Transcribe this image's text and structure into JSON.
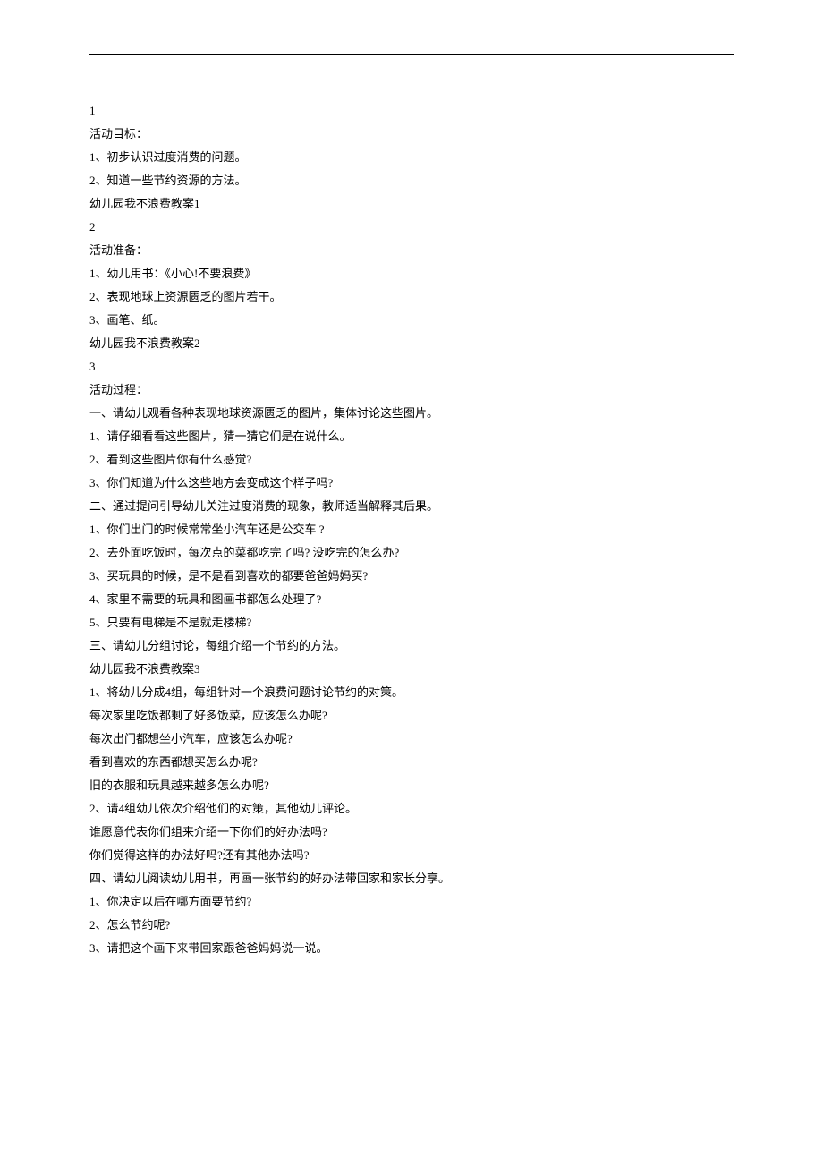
{
  "lines": [
    "1",
    "活动目标：",
    "1、初步认识过度消费的问题。",
    "2、知道一些节约资源的方法。",
    "幼儿园我不浪费教案1",
    "2",
    "活动准备：",
    "1、幼儿用书：《小心!不要浪费》",
    "2、表现地球上资源匮乏的图片若干。",
    "3、画笔、纸。",
    "幼儿园我不浪费教案2",
    "3",
    "活动过程：",
    "一、请幼儿观看各种表现地球资源匮乏的图片，集体讨论这些图片。",
    "1、请仔细看看这些图片，猜一猜它们是在说什么。",
    "2、看到这些图片你有什么感觉?",
    "3、你们知道为什么这些地方会变成这个样子吗?",
    "二、通过提问引导幼儿关注过度消费的现象，教师适当解释其后果。",
    "1、你们出门的时候常常坐小汽车还是公交车 ?",
    "2、去外面吃饭时，每次点的菜都吃完了吗? 没吃完的怎么办?",
    "3、买玩具的时候，是不是看到喜欢的都要爸爸妈妈买?",
    "4、家里不需要的玩具和图画书都怎么处理了?",
    "5、只要有电梯是不是就走楼梯?",
    "三、请幼儿分组讨论，每组介绍一个节约的方法。",
    "幼儿园我不浪费教案3",
    "1、将幼儿分成4组，每组针对一个浪费问题讨论节约的对策。",
    "每次家里吃饭都剩了好多饭菜，应该怎么办呢?",
    "每次出门都想坐小汽车，应该怎么办呢?",
    "看到喜欢的东西都想买怎么办呢?",
    "旧的衣服和玩具越来越多怎么办呢?",
    "2、请4组幼儿依次介绍他们的对策，其他幼儿评论。",
    "谁愿意代表你们组来介绍一下你们的好办法吗?",
    "你们觉得这样的办法好吗?还有其他办法吗?",
    "四、请幼儿阅读幼儿用书，再画一张节约的好办法带回家和家长分享。",
    "1、你决定以后在哪方面要节约?",
    "2、怎么节约呢?",
    "3、请把这个画下来带回家跟爸爸妈妈说一说。"
  ]
}
